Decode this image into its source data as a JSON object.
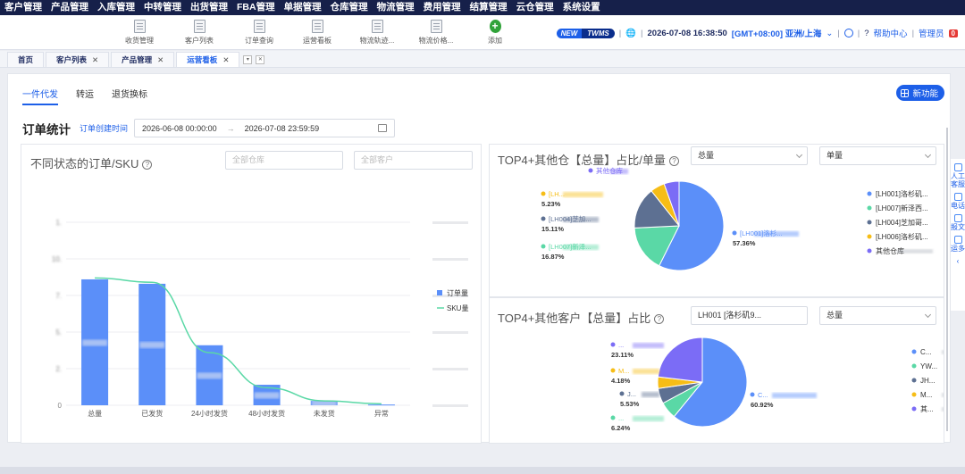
{
  "nav": [
    "客户管理",
    "产品管理",
    "入库管理",
    "中转管理",
    "出货管理",
    "FBA管理",
    "单据管理",
    "仓库管理",
    "物流管理",
    "费用管理",
    "结算管理",
    "云仓管理",
    "系统设置"
  ],
  "toolbar": {
    "items": [
      "收货管理",
      "客户列表",
      "订单查询",
      "运营看板",
      "物流轨迹...",
      "物流价格...",
      "添加"
    ]
  },
  "status": {
    "new_label": "NEW",
    "twms_label": "TWMS",
    "datetime": "2026-07-08 16:38:50",
    "timezone": "[GMT+08:00] 亚洲/上海",
    "help": "帮助中心",
    "admin": "管理员",
    "count": "0"
  },
  "tabs": [
    {
      "label": "首页",
      "closable": false
    },
    {
      "label": "客户列表",
      "closable": true
    },
    {
      "label": "产品管理",
      "closable": true
    },
    {
      "label": "运营看板",
      "closable": true
    }
  ],
  "subtabs": [
    "一件代发",
    "转运",
    "退货换标"
  ],
  "new_feature": "新功能",
  "stats": {
    "title": "订单统计",
    "subtitle": "订单创建时间",
    "date_from": "2026-06-08 00:00:00",
    "date_to": "2026-07-08 23:59:59"
  },
  "left_panel": {
    "title": "不同状态的订单/SKU",
    "warehouse_placeholder": "全部仓库",
    "customer_placeholder": "全部客户"
  },
  "right_top": {
    "title": "TOP4+其他仓【总量】占比/单量",
    "select1": "总量",
    "select2": "单量",
    "slice_labels": [
      "[LH001]洛杉...",
      "[LH007]新泽...",
      "[LH004]芝加...",
      "[LH...",
      "其他仓库"
    ],
    "legend": [
      "[LH001]洛杉矶...",
      "[LH007]新泽西...",
      "[LH004]芝加哥...",
      "[LH006]洛杉矶...",
      "其他仓库"
    ]
  },
  "right_bottom": {
    "title": "TOP4+其他客户【总量】占比",
    "select1": "LH001 [洛杉矶9...",
    "select2": "总量",
    "slice_labels": [
      "C...",
      "...",
      "J...",
      "M...",
      "..."
    ],
    "legend": [
      "C...",
      "YW...",
      "JH...",
      "M...",
      "其..."
    ]
  },
  "rail": [
    "人工客服",
    "电话",
    "报文",
    "运多"
  ],
  "chart_data": [
    {
      "type": "bar",
      "title": "不同状态的订单/SKU",
      "categories": [
        "总量",
        "已发货",
        "24小时发货",
        "48小时发货",
        "未发货",
        "异常"
      ],
      "yticks": [
        "0",
        "2.",
        "5.",
        "7.",
        "10.",
        "1."
      ],
      "ylim": [
        0,
        12.5
      ],
      "series": [
        {
          "name": "订单量",
          "type": "bar",
          "values": [
            8.6,
            8.3,
            4.1,
            1.4,
            0.3,
            0.05
          ]
        },
        {
          "name": "SKU量",
          "type": "line",
          "values": [
            8.7,
            8.4,
            3.6,
            1.2,
            0.3,
            0.1
          ]
        }
      ],
      "legend_position": "right"
    },
    {
      "type": "pie",
      "title": "TOP4+其他仓【总量】占比/单量",
      "slices": [
        {
          "label": "[LH001]洛杉矶",
          "value": 57.36,
          "color": "#5b8ff9"
        },
        {
          "label": "[LH007]新泽西",
          "value": 16.87,
          "color": "#5ad8a6"
        },
        {
          "label": "[LH004]芝加哥",
          "value": 15.11,
          "color": "#5d7092"
        },
        {
          "label": "[LH006]洛杉矶",
          "value": 5.23,
          "color": "#f6bd16"
        },
        {
          "label": "其他仓库",
          "value": 5.43,
          "color": "#7b6cf6"
        }
      ],
      "pct_labels": [
        "57.36%",
        "16.87%",
        "15.11%",
        "5.23%"
      ]
    },
    {
      "type": "pie",
      "title": "TOP4+其他客户【总量】占比",
      "slices": [
        {
          "label": "C...",
          "value": 60.92,
          "color": "#5b8ff9"
        },
        {
          "label": "YW...",
          "value": 6.24,
          "color": "#5ad8a6"
        },
        {
          "label": "JH...",
          "value": 5.53,
          "color": "#5d7092"
        },
        {
          "label": "M...",
          "value": 4.18,
          "color": "#f6bd16"
        },
        {
          "label": "其他",
          "value": 23.13,
          "color": "#7b6cf6"
        }
      ],
      "pct_labels": [
        "60.92%",
        "6.24%",
        "5.53%",
        "4.18%",
        "23.11%"
      ]
    }
  ]
}
